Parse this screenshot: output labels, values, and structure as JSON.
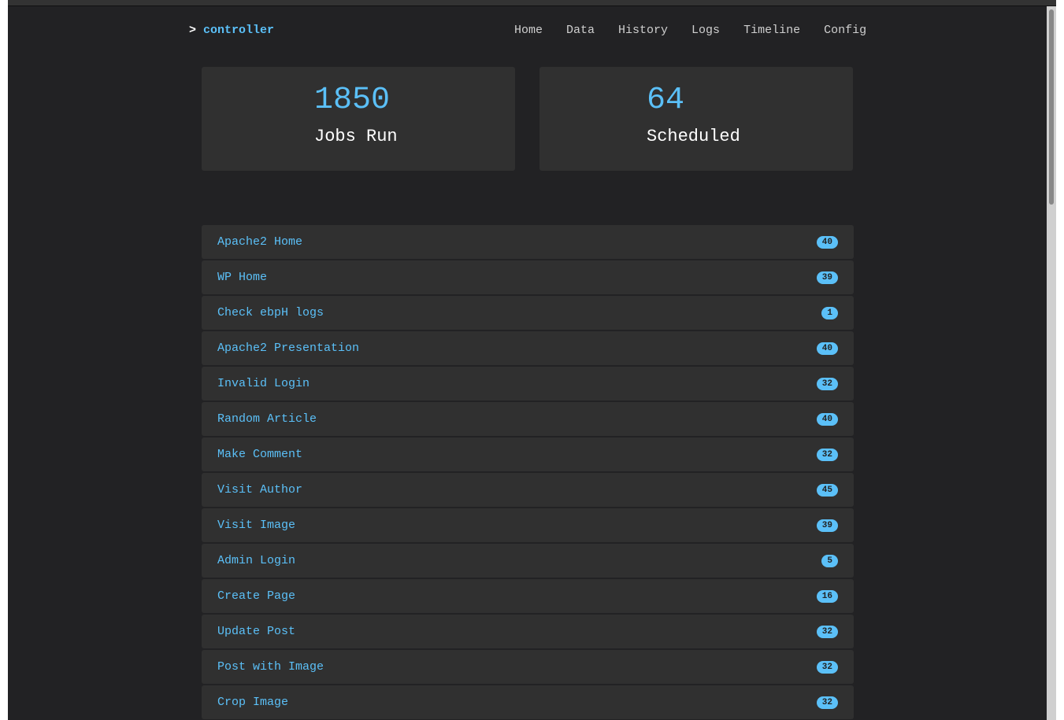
{
  "brand": {
    "prompt": ">",
    "name": "controller"
  },
  "nav": [
    "Home",
    "Data",
    "History",
    "Logs",
    "Timeline",
    "Config"
  ],
  "stats": [
    {
      "value": "1850",
      "label": "Jobs Run"
    },
    {
      "value": "64",
      "label": "Scheduled"
    }
  ],
  "jobs": [
    {
      "name": "Apache2 Home",
      "count": "40"
    },
    {
      "name": "WP Home",
      "count": "39"
    },
    {
      "name": "Check ebpH logs",
      "count": "1"
    },
    {
      "name": "Apache2 Presentation",
      "count": "40"
    },
    {
      "name": "Invalid Login",
      "count": "32"
    },
    {
      "name": "Random Article",
      "count": "40"
    },
    {
      "name": "Make Comment",
      "count": "32"
    },
    {
      "name": "Visit Author",
      "count": "45"
    },
    {
      "name": "Visit Image",
      "count": "39"
    },
    {
      "name": "Admin Login",
      "count": "5"
    },
    {
      "name": "Create Page",
      "count": "16"
    },
    {
      "name": "Update Post",
      "count": "32"
    },
    {
      "name": "Post with Image",
      "count": "32"
    },
    {
      "name": "Crop Image",
      "count": "32"
    }
  ],
  "colors": {
    "accent": "#5bc0f8",
    "background": "#222224",
    "card": "#303030"
  }
}
